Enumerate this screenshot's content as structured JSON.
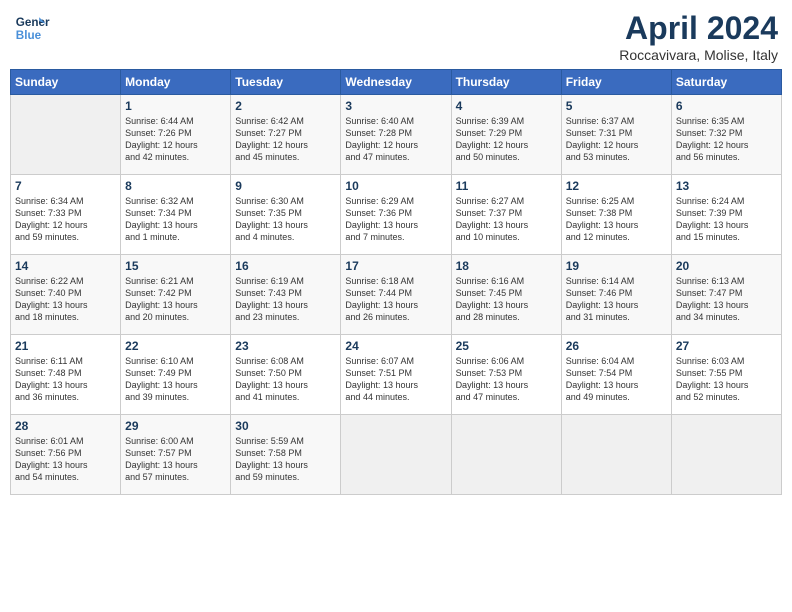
{
  "header": {
    "logo_line1": "General",
    "logo_line2": "Blue",
    "month_year": "April 2024",
    "location": "Roccavivara, Molise, Italy"
  },
  "weekdays": [
    "Sunday",
    "Monday",
    "Tuesday",
    "Wednesday",
    "Thursday",
    "Friday",
    "Saturday"
  ],
  "weeks": [
    [
      {
        "day": "",
        "info": ""
      },
      {
        "day": "1",
        "info": "Sunrise: 6:44 AM\nSunset: 7:26 PM\nDaylight: 12 hours\nand 42 minutes."
      },
      {
        "day": "2",
        "info": "Sunrise: 6:42 AM\nSunset: 7:27 PM\nDaylight: 12 hours\nand 45 minutes."
      },
      {
        "day": "3",
        "info": "Sunrise: 6:40 AM\nSunset: 7:28 PM\nDaylight: 12 hours\nand 47 minutes."
      },
      {
        "day": "4",
        "info": "Sunrise: 6:39 AM\nSunset: 7:29 PM\nDaylight: 12 hours\nand 50 minutes."
      },
      {
        "day": "5",
        "info": "Sunrise: 6:37 AM\nSunset: 7:31 PM\nDaylight: 12 hours\nand 53 minutes."
      },
      {
        "day": "6",
        "info": "Sunrise: 6:35 AM\nSunset: 7:32 PM\nDaylight: 12 hours\nand 56 minutes."
      }
    ],
    [
      {
        "day": "7",
        "info": "Sunrise: 6:34 AM\nSunset: 7:33 PM\nDaylight: 12 hours\nand 59 minutes."
      },
      {
        "day": "8",
        "info": "Sunrise: 6:32 AM\nSunset: 7:34 PM\nDaylight: 13 hours\nand 1 minute."
      },
      {
        "day": "9",
        "info": "Sunrise: 6:30 AM\nSunset: 7:35 PM\nDaylight: 13 hours\nand 4 minutes."
      },
      {
        "day": "10",
        "info": "Sunrise: 6:29 AM\nSunset: 7:36 PM\nDaylight: 13 hours\nand 7 minutes."
      },
      {
        "day": "11",
        "info": "Sunrise: 6:27 AM\nSunset: 7:37 PM\nDaylight: 13 hours\nand 10 minutes."
      },
      {
        "day": "12",
        "info": "Sunrise: 6:25 AM\nSunset: 7:38 PM\nDaylight: 13 hours\nand 12 minutes."
      },
      {
        "day": "13",
        "info": "Sunrise: 6:24 AM\nSunset: 7:39 PM\nDaylight: 13 hours\nand 15 minutes."
      }
    ],
    [
      {
        "day": "14",
        "info": "Sunrise: 6:22 AM\nSunset: 7:40 PM\nDaylight: 13 hours\nand 18 minutes."
      },
      {
        "day": "15",
        "info": "Sunrise: 6:21 AM\nSunset: 7:42 PM\nDaylight: 13 hours\nand 20 minutes."
      },
      {
        "day": "16",
        "info": "Sunrise: 6:19 AM\nSunset: 7:43 PM\nDaylight: 13 hours\nand 23 minutes."
      },
      {
        "day": "17",
        "info": "Sunrise: 6:18 AM\nSunset: 7:44 PM\nDaylight: 13 hours\nand 26 minutes."
      },
      {
        "day": "18",
        "info": "Sunrise: 6:16 AM\nSunset: 7:45 PM\nDaylight: 13 hours\nand 28 minutes."
      },
      {
        "day": "19",
        "info": "Sunrise: 6:14 AM\nSunset: 7:46 PM\nDaylight: 13 hours\nand 31 minutes."
      },
      {
        "day": "20",
        "info": "Sunrise: 6:13 AM\nSunset: 7:47 PM\nDaylight: 13 hours\nand 34 minutes."
      }
    ],
    [
      {
        "day": "21",
        "info": "Sunrise: 6:11 AM\nSunset: 7:48 PM\nDaylight: 13 hours\nand 36 minutes."
      },
      {
        "day": "22",
        "info": "Sunrise: 6:10 AM\nSunset: 7:49 PM\nDaylight: 13 hours\nand 39 minutes."
      },
      {
        "day": "23",
        "info": "Sunrise: 6:08 AM\nSunset: 7:50 PM\nDaylight: 13 hours\nand 41 minutes."
      },
      {
        "day": "24",
        "info": "Sunrise: 6:07 AM\nSunset: 7:51 PM\nDaylight: 13 hours\nand 44 minutes."
      },
      {
        "day": "25",
        "info": "Sunrise: 6:06 AM\nSunset: 7:53 PM\nDaylight: 13 hours\nand 47 minutes."
      },
      {
        "day": "26",
        "info": "Sunrise: 6:04 AM\nSunset: 7:54 PM\nDaylight: 13 hours\nand 49 minutes."
      },
      {
        "day": "27",
        "info": "Sunrise: 6:03 AM\nSunset: 7:55 PM\nDaylight: 13 hours\nand 52 minutes."
      }
    ],
    [
      {
        "day": "28",
        "info": "Sunrise: 6:01 AM\nSunset: 7:56 PM\nDaylight: 13 hours\nand 54 minutes."
      },
      {
        "day": "29",
        "info": "Sunrise: 6:00 AM\nSunset: 7:57 PM\nDaylight: 13 hours\nand 57 minutes."
      },
      {
        "day": "30",
        "info": "Sunrise: 5:59 AM\nSunset: 7:58 PM\nDaylight: 13 hours\nand 59 minutes."
      },
      {
        "day": "",
        "info": ""
      },
      {
        "day": "",
        "info": ""
      },
      {
        "day": "",
        "info": ""
      },
      {
        "day": "",
        "info": ""
      }
    ]
  ]
}
